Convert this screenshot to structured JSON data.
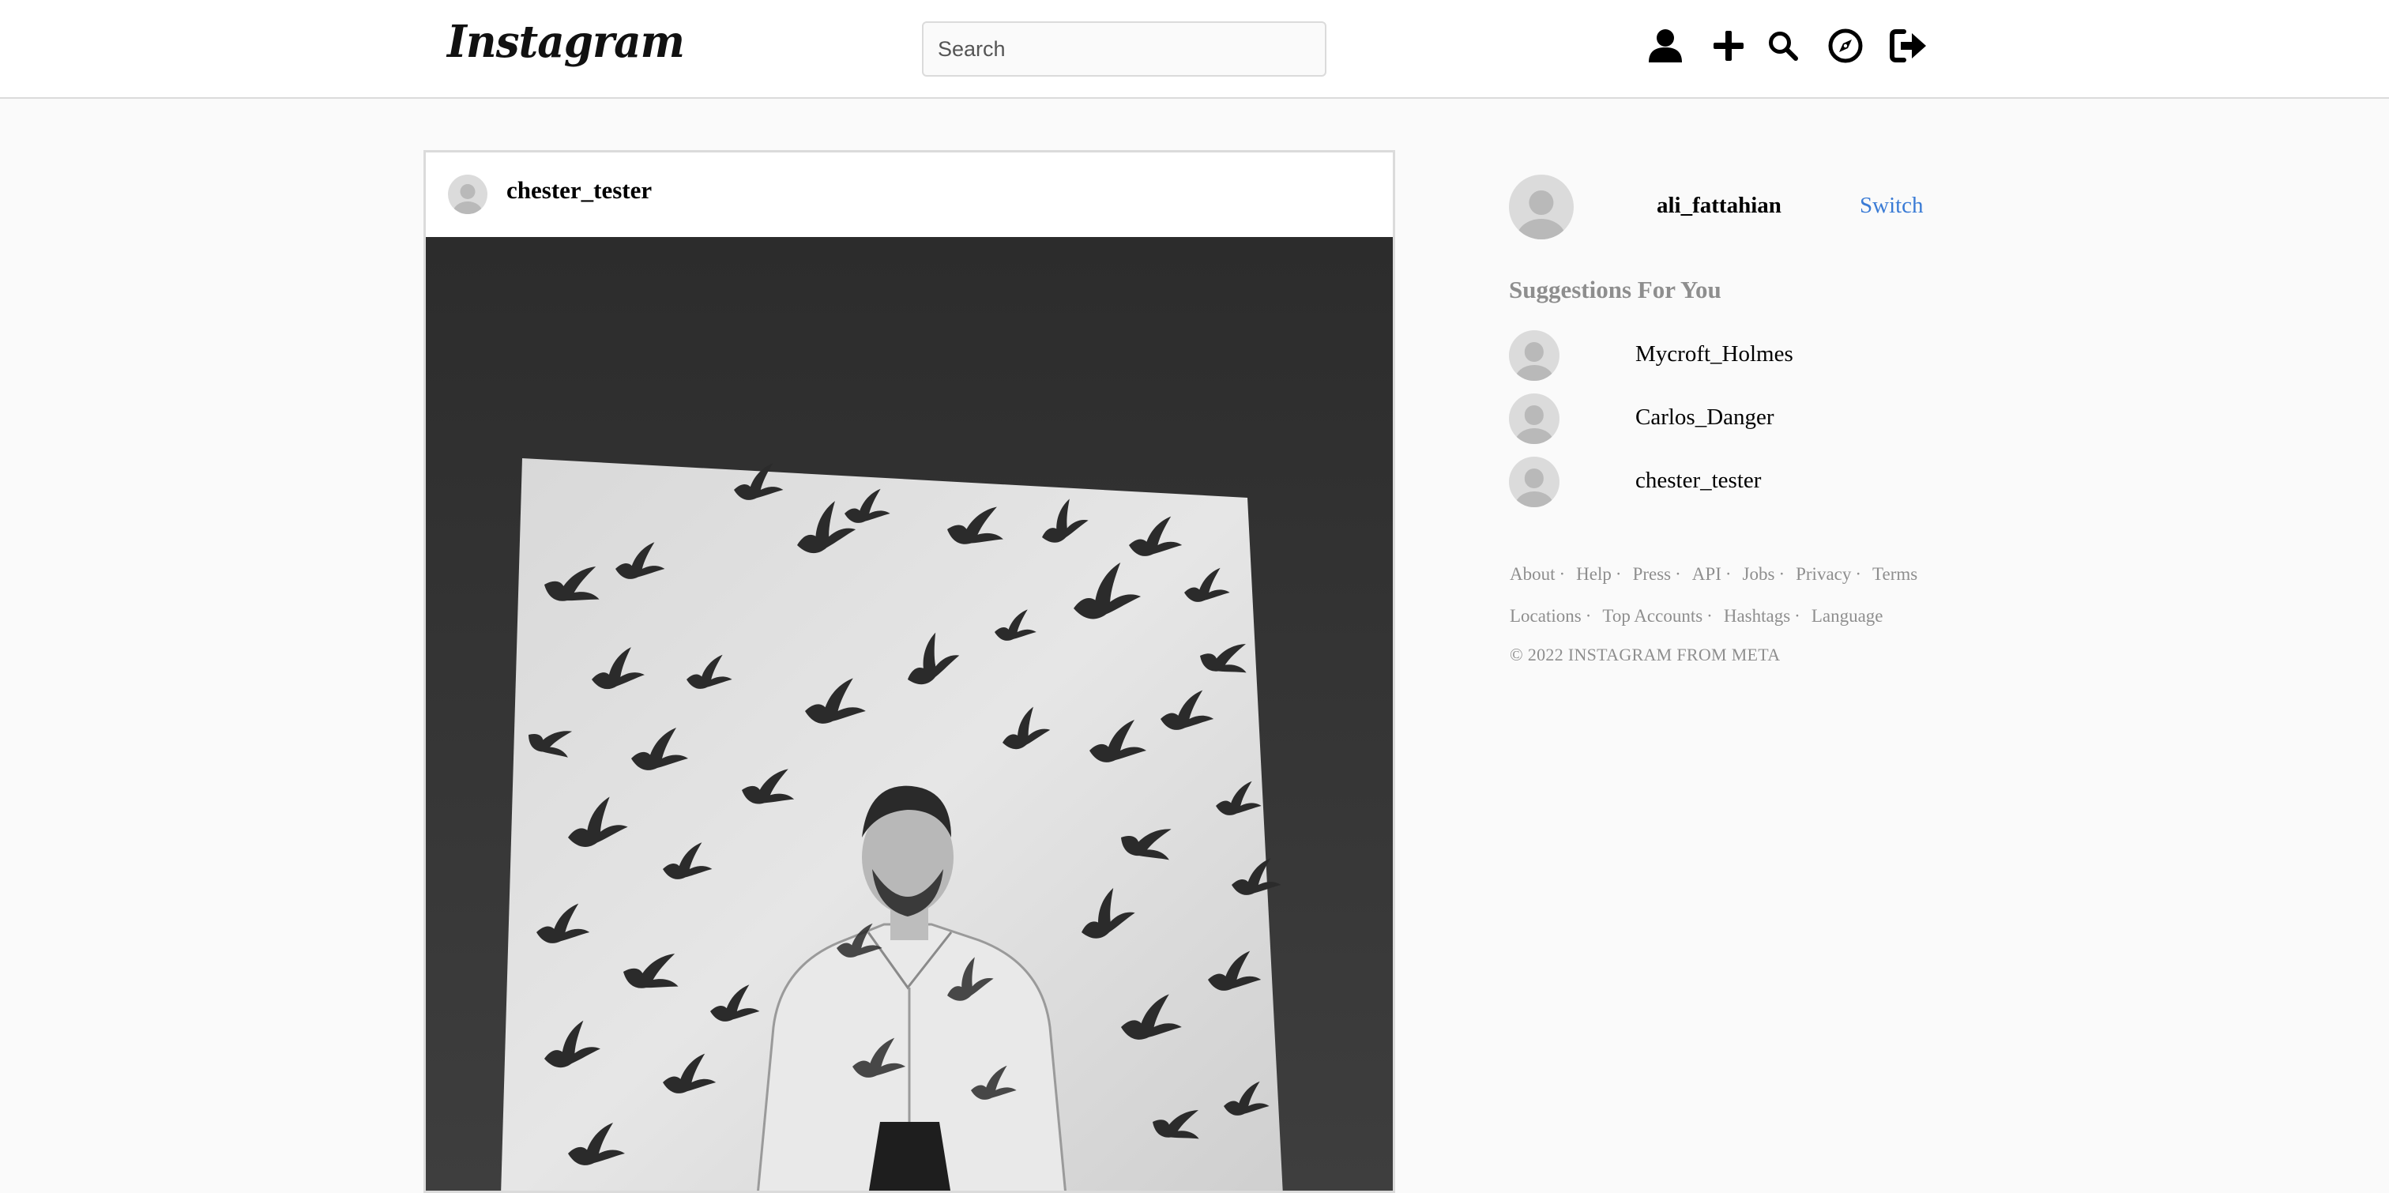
{
  "header": {
    "logo_text": "Instagram",
    "search_placeholder": "Search",
    "icons": [
      "profile-icon",
      "plus-icon",
      "search-icon",
      "explore-compass-icon",
      "logout-icon"
    ]
  },
  "post": {
    "username": "chester_tester",
    "image_description": "Black and white photo of a man in a white shirt looking up, standing before a backdrop with bird silhouettes"
  },
  "sidebar": {
    "current_user": "ali_fattahian",
    "switch_label": "Switch",
    "suggestions_title": "Suggestions For You",
    "suggestions": [
      {
        "username": "Mycroft_Holmes"
      },
      {
        "username": "Carlos_Danger"
      },
      {
        "username": "chester_tester"
      }
    ]
  },
  "footer": {
    "links_row1": [
      "About",
      "Help",
      "Press",
      "API",
      "Jobs",
      "Privacy",
      "Terms"
    ],
    "links_row2": [
      "Locations",
      "Top Accounts",
      "Hashtags",
      "Language"
    ],
    "copyright": "© 2022 INSTAGRAM FROM META"
  },
  "colors": {
    "background": "#fafafa",
    "border": "#dbdbdb",
    "link_blue": "#3a7bd5",
    "muted_text": "#8e8e8e"
  }
}
